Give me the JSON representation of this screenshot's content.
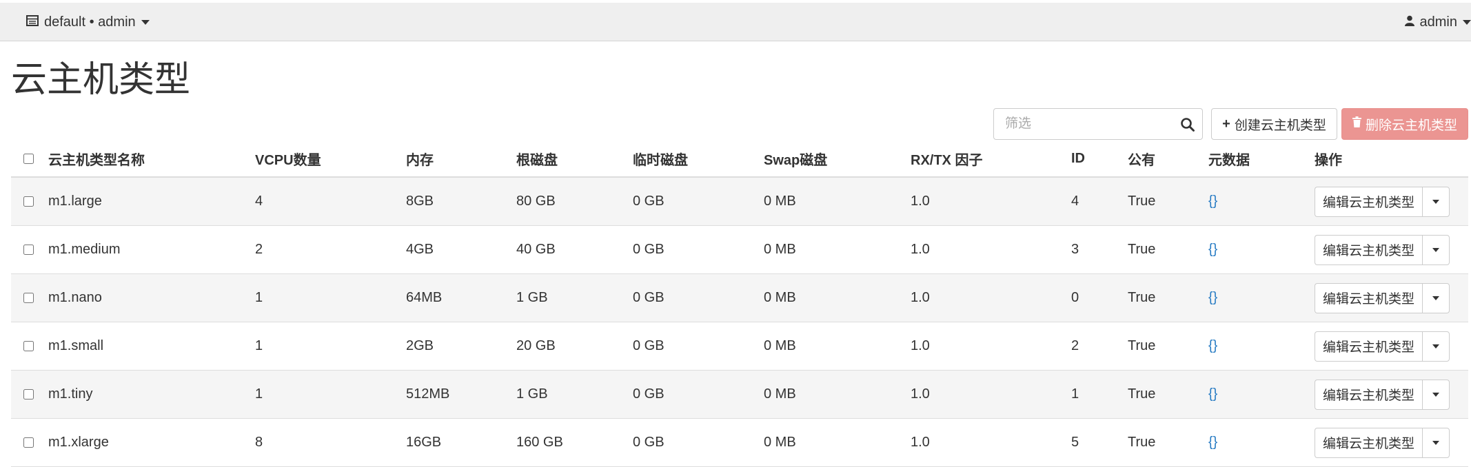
{
  "topbar": {
    "project": "default • admin",
    "user": "admin"
  },
  "page": {
    "title": "云主机类型"
  },
  "toolbar": {
    "filter_placeholder": "筛选",
    "create_label": "创建云主机类型",
    "delete_label": "删除云主机类型"
  },
  "table": {
    "headers": {
      "name": "云主机类型名称",
      "vcpus": "VCPU数量",
      "ram": "内存",
      "root_disk": "根磁盘",
      "ephemeral": "临时磁盘",
      "swap": "Swap磁盘",
      "rxtx": "RX/TX 因子",
      "id": "ID",
      "public": "公有",
      "metadata": "元数据",
      "actions": "操作"
    },
    "rows": [
      {
        "name": "m1.large",
        "vcpus": "4",
        "ram": "8GB",
        "root_disk": "80 GB",
        "ephemeral": "0 GB",
        "swap": "0 MB",
        "rxtx": "1.0",
        "id": "4",
        "public": "True",
        "metadata": "{}",
        "action": "编辑云主机类型"
      },
      {
        "name": "m1.medium",
        "vcpus": "2",
        "ram": "4GB",
        "root_disk": "40 GB",
        "ephemeral": "0 GB",
        "swap": "0 MB",
        "rxtx": "1.0",
        "id": "3",
        "public": "True",
        "metadata": "{}",
        "action": "编辑云主机类型"
      },
      {
        "name": "m1.nano",
        "vcpus": "1",
        "ram": "64MB",
        "root_disk": "1 GB",
        "ephemeral": "0 GB",
        "swap": "0 MB",
        "rxtx": "1.0",
        "id": "0",
        "public": "True",
        "metadata": "{}",
        "action": "编辑云主机类型"
      },
      {
        "name": "m1.small",
        "vcpus": "1",
        "ram": "2GB",
        "root_disk": "20 GB",
        "ephemeral": "0 GB",
        "swap": "0 MB",
        "rxtx": "1.0",
        "id": "2",
        "public": "True",
        "metadata": "{}",
        "action": "编辑云主机类型"
      },
      {
        "name": "m1.tiny",
        "vcpus": "1",
        "ram": "512MB",
        "root_disk": "1 GB",
        "ephemeral": "0 GB",
        "swap": "0 MB",
        "rxtx": "1.0",
        "id": "1",
        "public": "True",
        "metadata": "{}",
        "action": "编辑云主机类型"
      },
      {
        "name": "m1.xlarge",
        "vcpus": "8",
        "ram": "16GB",
        "root_disk": "160 GB",
        "ephemeral": "0 GB",
        "swap": "0 MB",
        "rxtx": "1.0",
        "id": "5",
        "public": "True",
        "metadata": "{}",
        "action": "编辑云主机类型"
      }
    ]
  },
  "colors": {
    "topbar_bg": "#efefef",
    "link": "#2a7dc4",
    "danger_button": "#eb9592",
    "row_stripe": "#f5f5f5"
  },
  "icons": {
    "project": "table-list-icon",
    "user": "user-icon",
    "search": "search-icon",
    "create": "plus-icon",
    "delete": "trash-icon"
  }
}
